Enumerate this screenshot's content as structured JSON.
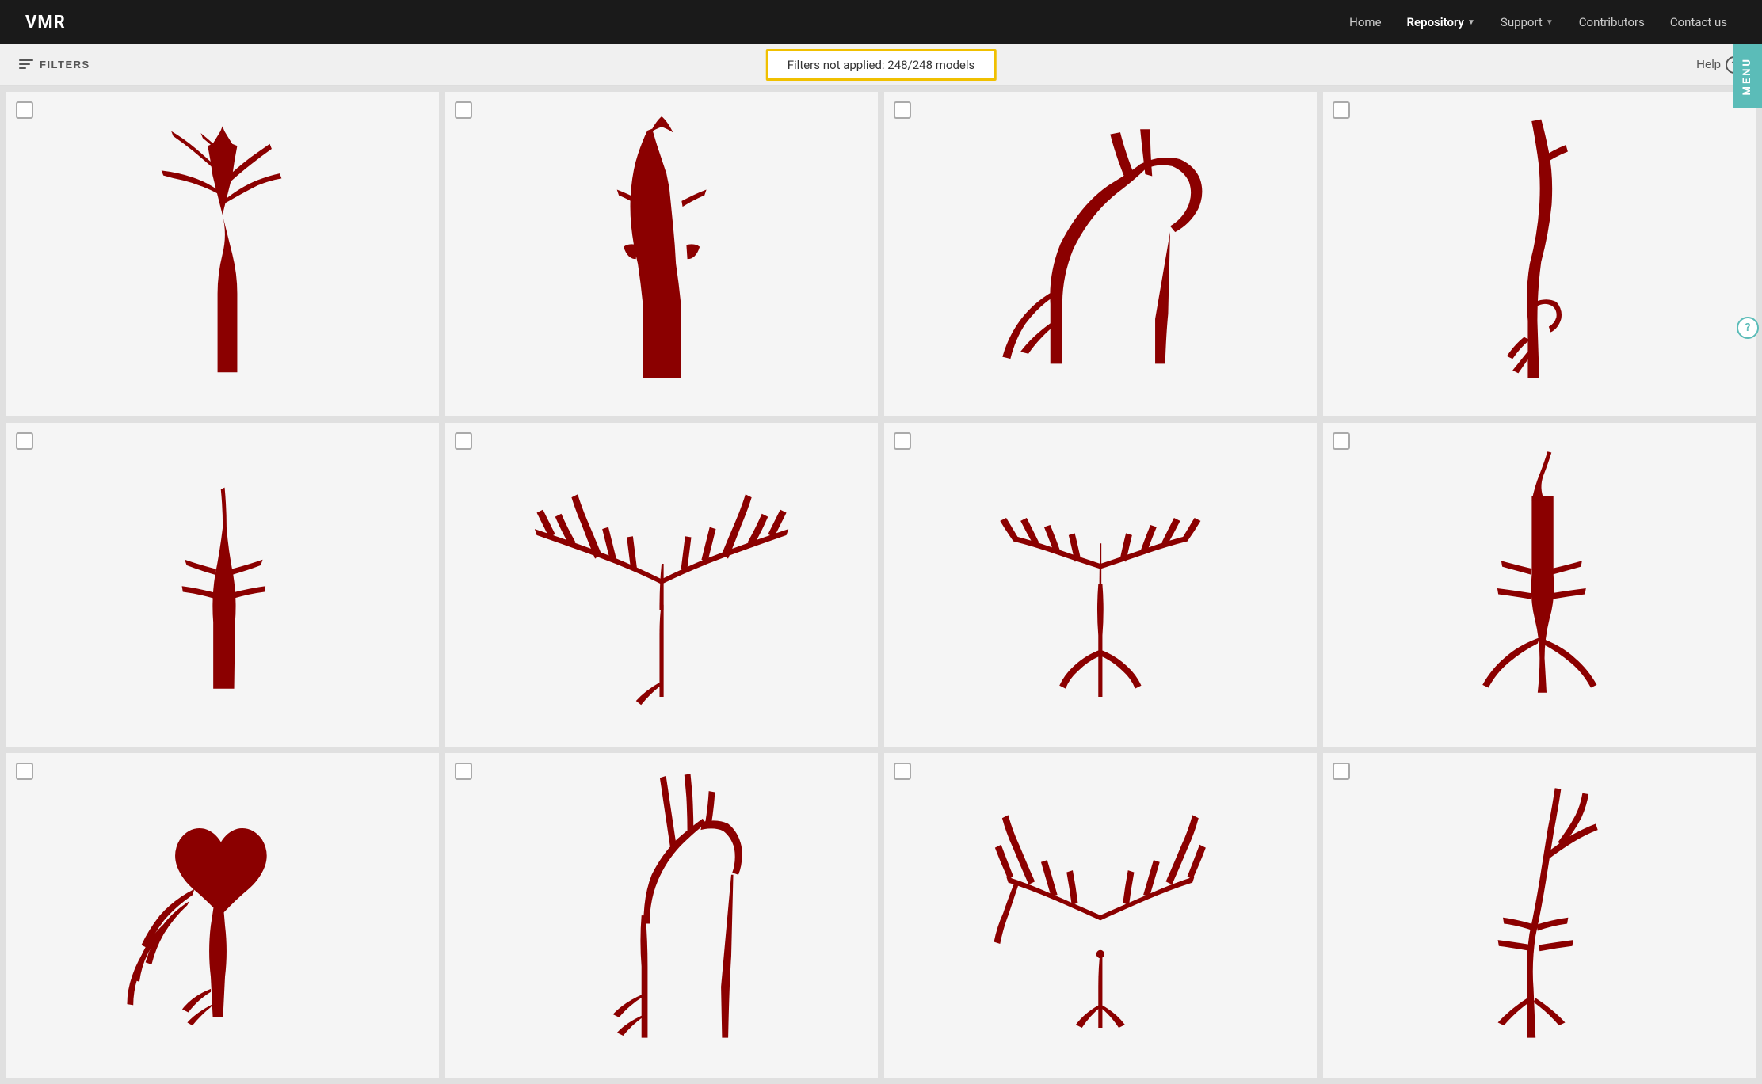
{
  "app": {
    "logo": "VMR"
  },
  "navbar": {
    "home_label": "Home",
    "repository_label": "Repository",
    "support_label": "Support",
    "contributors_label": "Contributors",
    "contact_label": "Contact us"
  },
  "filter_bar": {
    "filters_label": "FILTERS",
    "status_text": "Filters not applied: 248/248 models",
    "help_label": "Help"
  },
  "side_menu": {
    "label": "MENU",
    "help_icon": "?"
  },
  "models": [
    {
      "id": 1,
      "shape": "aorta_branching_tall"
    },
    {
      "id": 2,
      "shape": "aorta_narrow_vase"
    },
    {
      "id": 3,
      "shape": "aorta_arch_complex"
    },
    {
      "id": 4,
      "shape": "aorta_single_curve"
    },
    {
      "id": 5,
      "shape": "aorta_abdominal_small"
    },
    {
      "id": 6,
      "shape": "aorta_pulmonary_tree"
    },
    {
      "id": 7,
      "shape": "aorta_renal_branches"
    },
    {
      "id": 8,
      "shape": "aorta_iliac_branches"
    },
    {
      "id": 9,
      "shape": "aorta_heart_vessels"
    },
    {
      "id": 10,
      "shape": "aorta_arch_branches"
    },
    {
      "id": 11,
      "shape": "aorta_lung_tree"
    },
    {
      "id": 12,
      "shape": "aorta_abdominal_curved"
    }
  ],
  "colors": {
    "model_fill": "#8b0000",
    "nav_bg": "#1a1a1a",
    "card_bg": "#f5f5f5",
    "filter_border": "#f0c000",
    "side_menu_bg": "#5bbcb8"
  }
}
